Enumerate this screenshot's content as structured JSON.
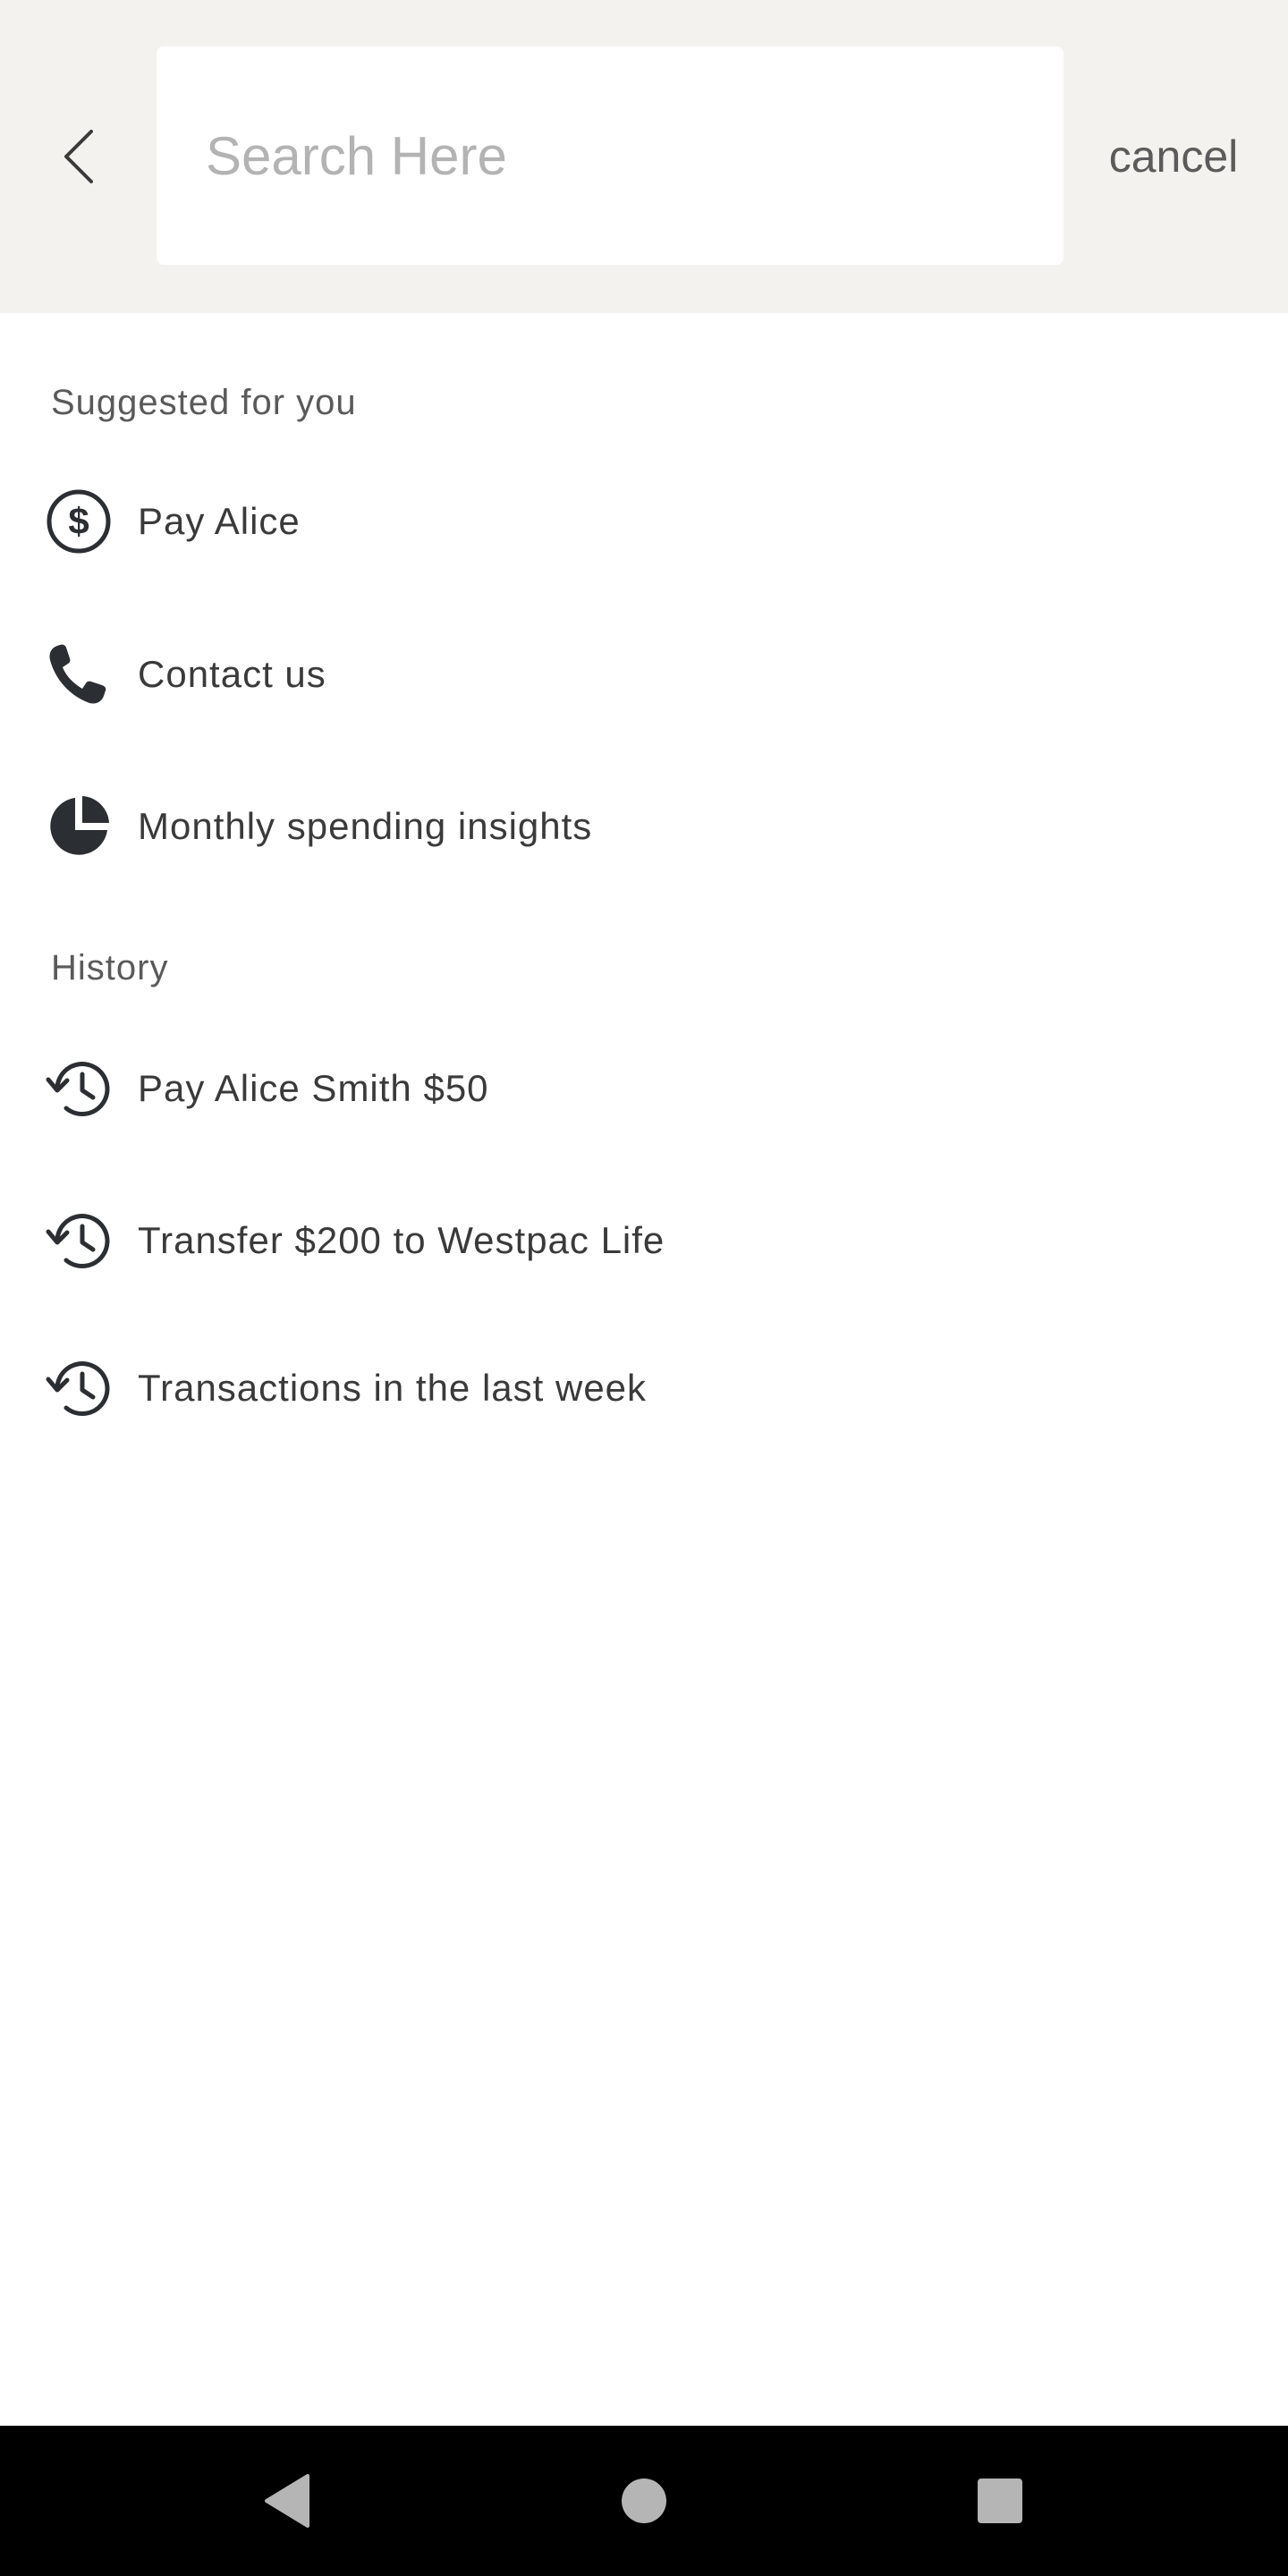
{
  "header": {
    "back_icon": "chevron-left-icon",
    "search_placeholder": "Search Here",
    "search_value": "",
    "cancel_label": "cancel"
  },
  "suggested": {
    "title": "Suggested for you",
    "items": [
      {
        "label": "Pay Alice",
        "icon": "dollar-circle-icon"
      },
      {
        "label": "Contact us",
        "icon": "phone-icon"
      },
      {
        "label": "Monthly spending insights",
        "icon": "pie-chart-icon"
      }
    ]
  },
  "history": {
    "title": "History",
    "items": [
      {
        "label": "Pay Alice Smith $50",
        "icon": "history-icon"
      },
      {
        "label": "Transfer $200 to Westpac Life",
        "icon": "history-icon"
      },
      {
        "label": "Transactions in the last week",
        "icon": "history-icon"
      }
    ]
  },
  "system_nav": {
    "back_icon": "triangle-back-icon",
    "home_icon": "circle-home-icon",
    "recents_icon": "square-recents-icon"
  },
  "colors": {
    "header_bg": "#f3f2ef",
    "icon": "#2b2f33",
    "nav_bg": "#000000",
    "nav_icon": "#b5b5b5"
  }
}
